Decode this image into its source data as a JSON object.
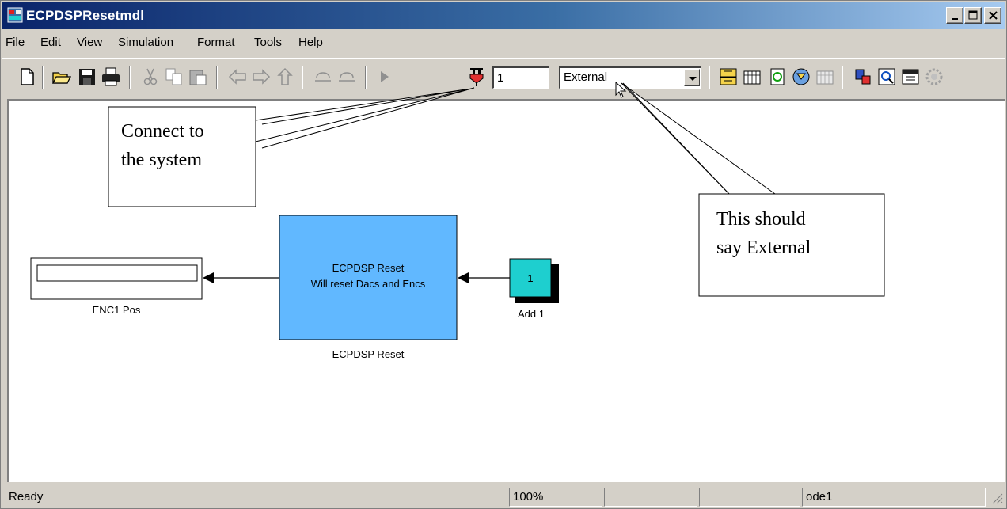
{
  "window": {
    "title": "ECPDSPResetmdl"
  },
  "menu": [
    {
      "label": "File",
      "accel": "F"
    },
    {
      "label": "Edit",
      "accel": "E"
    },
    {
      "label": "View",
      "accel": "V"
    },
    {
      "label": "Simulation",
      "accel": "S"
    },
    {
      "label": "Format",
      "accel": "o"
    },
    {
      "label": "Tools",
      "accel": "T"
    },
    {
      "label": "Help",
      "accel": "H"
    }
  ],
  "toolbar": {
    "stop_time": "1",
    "simulation_mode": "External"
  },
  "blocks": {
    "display": {
      "name": "ENC1 Pos"
    },
    "reset": {
      "line1": "ECPDSP Reset",
      "line2": "Will reset Dacs and Encs",
      "name": "ECPDSP Reset"
    },
    "constant": {
      "value": "1",
      "name": "Add 1"
    }
  },
  "callouts": {
    "connect": {
      "line1": "Connect to",
      "line2": "the system"
    },
    "external": {
      "line1": "This should",
      "line2": "say External"
    }
  },
  "status": {
    "state": "Ready",
    "zoom": "100%",
    "solver": "ode1"
  },
  "colors": {
    "reset_block": "#61b8ff",
    "constant_block": "#1ecfcf",
    "title_gradient_start": "#0a246a"
  }
}
